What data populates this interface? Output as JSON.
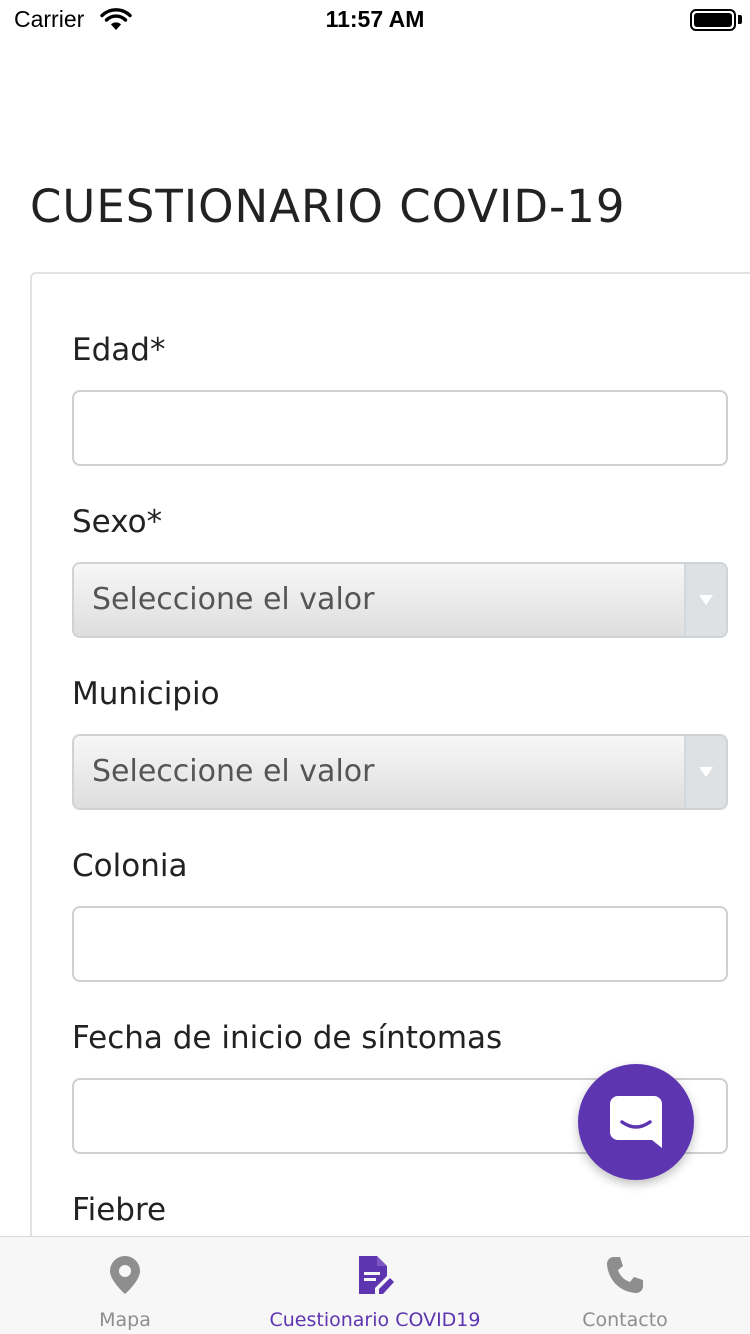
{
  "status_bar": {
    "carrier": "Carrier",
    "time": "11:57 AM"
  },
  "page": {
    "title": "CUESTIONARIO COVID-19"
  },
  "form": {
    "edad": {
      "label": "Edad*",
      "value": ""
    },
    "sexo": {
      "label": "Sexo*",
      "selected": "Seleccione el valor"
    },
    "municipio": {
      "label": "Municipio",
      "selected": "Seleccione el valor"
    },
    "colonia": {
      "label": "Colonia",
      "value": ""
    },
    "fecha_inicio": {
      "label": "Fecha de inicio de síntomas",
      "value": ""
    },
    "fiebre": {
      "label": "Fiebre"
    }
  },
  "chat": {
    "icon": "chat-bubble-icon"
  },
  "tab_bar": {
    "tabs": [
      {
        "label": "Mapa",
        "icon": "map-pin-icon",
        "active": false
      },
      {
        "label": "Cuestionario COVID19",
        "icon": "document-edit-icon",
        "active": true
      },
      {
        "label": "Contacto",
        "icon": "phone-icon",
        "active": false
      }
    ]
  },
  "colors": {
    "accent": "#5e35b1",
    "inactive_tab": "#8e8e8e",
    "input_border": "#d0d0d0",
    "text": "#222222"
  }
}
